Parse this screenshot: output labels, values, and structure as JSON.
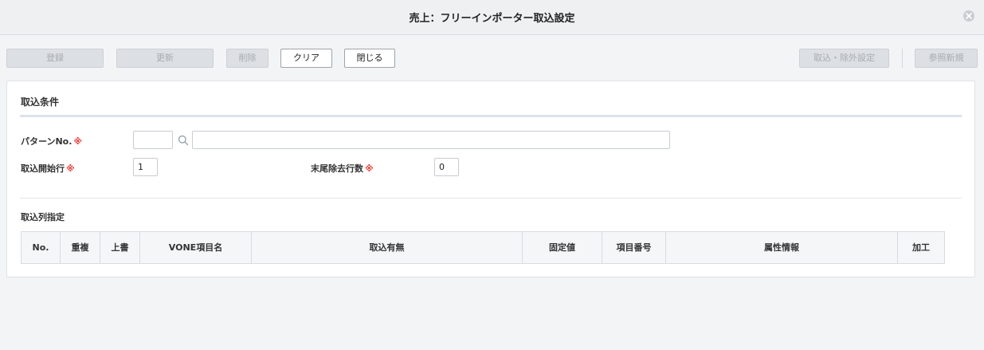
{
  "window": {
    "title": "売上：フリーインポーター取込設定"
  },
  "toolbar": {
    "register": "登録",
    "update": "更新",
    "delete": "削除",
    "clear": "クリア",
    "close": "閉じる",
    "import_exclude_settings": "取込・除外設定",
    "reference_new": "参照新規"
  },
  "conditions": {
    "section_title": "取込条件",
    "pattern_no_label": "パターンNo.",
    "required_mark": "※",
    "pattern_no_value": "",
    "pattern_name_value": "",
    "start_row_label": "取込開始行",
    "start_row_value": "1",
    "tail_exclude_label": "末尾除去行数",
    "tail_exclude_value": "0"
  },
  "columns_spec": {
    "title": "取込列指定",
    "headers": [
      "No.",
      "重複",
      "上書",
      "VONE項目名",
      "取込有無",
      "固定値",
      "項目番号",
      "属性情報",
      "加工"
    ]
  }
}
